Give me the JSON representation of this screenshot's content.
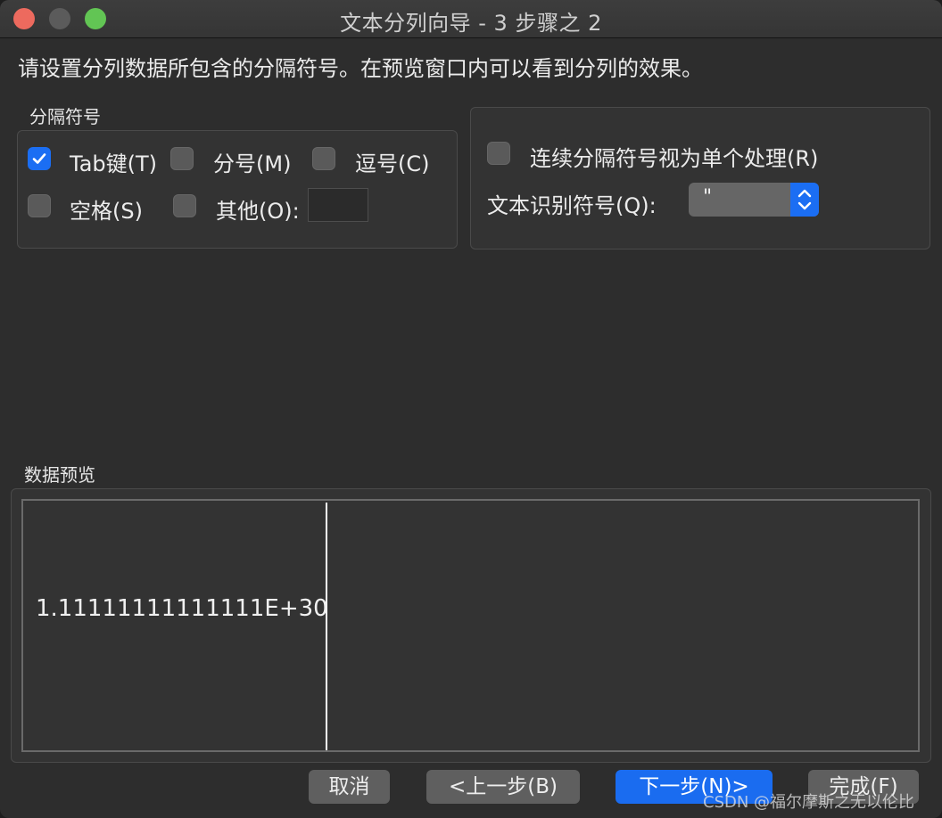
{
  "window": {
    "title": "文本分列向导 - 3 步骤之 2"
  },
  "instruction": "请设置分列数据所包含的分隔符号。在预览窗口内可以看到分列的效果。",
  "delimiters": {
    "group_label": "分隔符号",
    "tab": {
      "label": "Tab键(T)",
      "checked": true
    },
    "semicolon": {
      "label": "分号(M)",
      "checked": false
    },
    "comma": {
      "label": "逗号(C)",
      "checked": false
    },
    "space": {
      "label": "空格(S)",
      "checked": false
    },
    "other": {
      "label": "其他(O):",
      "checked": false,
      "value": ""
    }
  },
  "options": {
    "consecutive": {
      "label": "连续分隔符号视为单个处理(R)",
      "checked": false
    },
    "text_qualifier": {
      "label": "文本识别符号(Q):",
      "value": "\""
    }
  },
  "preview": {
    "label": "数据预览",
    "cell": "1.11111111111111E+30"
  },
  "buttons": {
    "cancel": "取消",
    "back": "<上一步(B)",
    "next": "下一步(N)>",
    "finish": "完成(F)"
  },
  "watermark": "CSDN @福尔摩斯之无以伦比",
  "colors": {
    "accent": "#1a6cf0",
    "background": "#2d2d2d",
    "close": "#ed6a5e",
    "maximize": "#62c554"
  }
}
